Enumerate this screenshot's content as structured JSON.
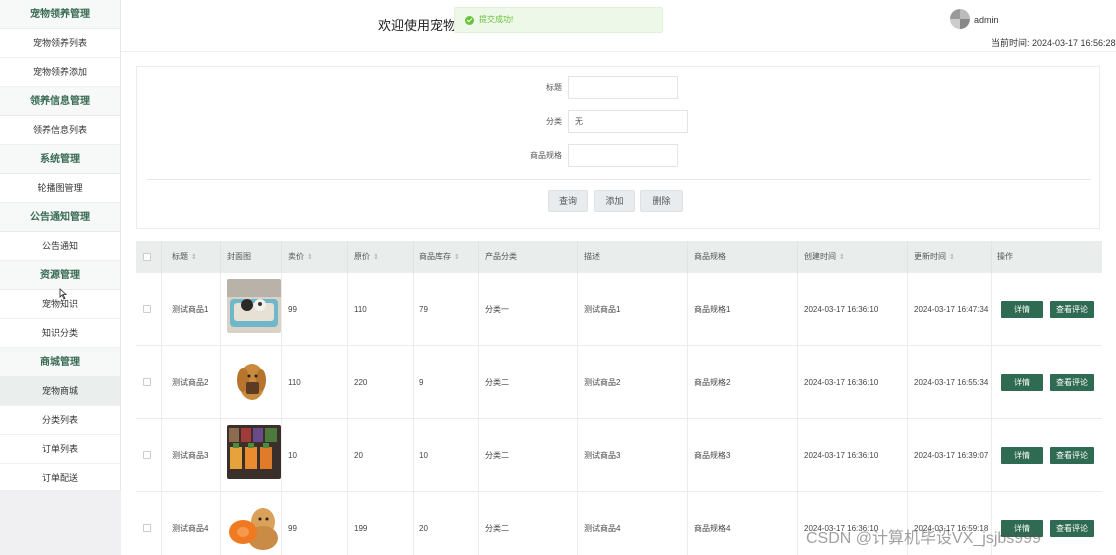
{
  "sidebar": {
    "groups": [
      {
        "title": "宠物领养管理",
        "items": [
          "宠物领养列表",
          "宠物领养添加"
        ]
      },
      {
        "title": "领养信息管理",
        "items": [
          "领养信息列表"
        ]
      },
      {
        "title": "系统管理",
        "items": [
          "轮播图管理"
        ]
      },
      {
        "title": "公告通知管理",
        "items": [
          "公告通知"
        ]
      },
      {
        "title": "资源管理",
        "items": [
          "宠物知识",
          "知识分类"
        ]
      },
      {
        "title": "商城管理",
        "items": [
          "宠物商城",
          "分类列表",
          "订单列表",
          "订单配送"
        ]
      }
    ]
  },
  "header": {
    "welcome": "欢迎使用宠物",
    "toast": "提交成功!",
    "user": "admin",
    "time_label": "当前时间: 2024-03-17 16:56:28"
  },
  "search": {
    "fields": [
      {
        "label": "标题",
        "value": ""
      },
      {
        "label": "分类",
        "value": "无"
      },
      {
        "label": "商品规格",
        "value": ""
      }
    ],
    "buttons": [
      "查询",
      "添加",
      "删除"
    ]
  },
  "table": {
    "headers": [
      "标题",
      "封面图",
      "卖价",
      "原价",
      "商品库存",
      "产品分类",
      "描述",
      "商品规格",
      "创建时间",
      "更新时间",
      "操作"
    ],
    "rows": [
      {
        "title": "测试商品1",
        "sell": "99",
        "orig": "110",
        "stock": "79",
        "cat": "分类一",
        "desc": "测试商品1",
        "spec": "商品规格1",
        "created": "2024-03-17 16:36:10",
        "updated": "2024-03-17 16:47:34"
      },
      {
        "title": "测试商品2",
        "sell": "110",
        "orig": "220",
        "stock": "9",
        "cat": "分类二",
        "desc": "测试商品2",
        "spec": "商品规格2",
        "created": "2024-03-17 16:36:10",
        "updated": "2024-03-17 16:55:34"
      },
      {
        "title": "测试商品3",
        "sell": "10",
        "orig": "20",
        "stock": "10",
        "cat": "分类二",
        "desc": "测试商品3",
        "spec": "商品规格3",
        "created": "2024-03-17 16:36:10",
        "updated": "2024-03-17 16:39:07"
      },
      {
        "title": "测试商品4",
        "sell": "99",
        "orig": "199",
        "stock": "20",
        "cat": "分类二",
        "desc": "测试商品4",
        "spec": "商品规格4",
        "created": "2024-03-17 16:36:10",
        "updated": "2024-03-17 16:59:18"
      }
    ],
    "actions": {
      "detail": "详情",
      "comments": "查看评论"
    }
  },
  "watermark": "CSDN @计算机毕设VX_jsjbs999",
  "colors": {
    "accent": "#2f6b53",
    "group_title": "#3a6b55",
    "toast_green": "#67c23a"
  }
}
